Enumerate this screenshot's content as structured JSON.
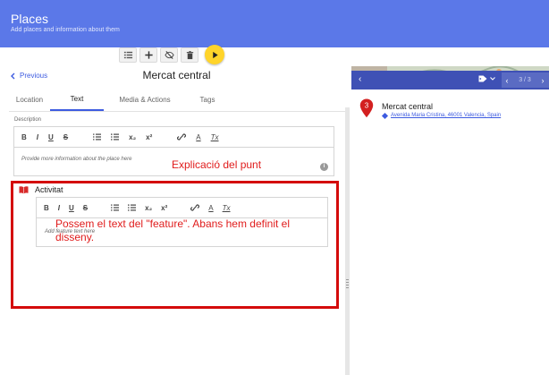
{
  "header": {
    "title": "Places",
    "subtitle": "Add places and information about them"
  },
  "toolbar": {
    "buttons": [
      "list-icon",
      "add-icon",
      "hide-icon",
      "delete-icon",
      "play-icon"
    ],
    "accent": "#ffd42a"
  },
  "editor": {
    "prev_label": "Previous",
    "place_title": "Mercat central",
    "tabs": [
      "Location",
      "Text",
      "Media & Actions",
      "Tags"
    ],
    "active_tab": "Text",
    "description_label": "Description",
    "description_placeholder": "Provide more information about the place here",
    "feature": {
      "label": "Activitat",
      "placeholder": "Add feature text here"
    },
    "format_buttons": {
      "bold": "B",
      "italic": "I",
      "underline": "U",
      "strike": "S",
      "subscript": "x₂",
      "superscript": "x²",
      "color": "A",
      "clear": "Tx"
    }
  },
  "annotations": {
    "description_note": "Explicació del punt",
    "feature_note": "Possem el text del \"feature\". Abans hem definit el disseny."
  },
  "preview": {
    "back": "‹",
    "pager": {
      "prev": "‹",
      "count": "3 / 3",
      "next": "›"
    },
    "pin_number": "3",
    "place_name": "Mercat central",
    "address": "Avenida Maria Cristina, 46001 Valencia, Spain"
  },
  "colors": {
    "header": "#5b78e8",
    "preview_header": "#3f51b5",
    "annotation": "#e01c1c",
    "highlight_box": "#d40b0b",
    "link": "#3d5be0"
  }
}
